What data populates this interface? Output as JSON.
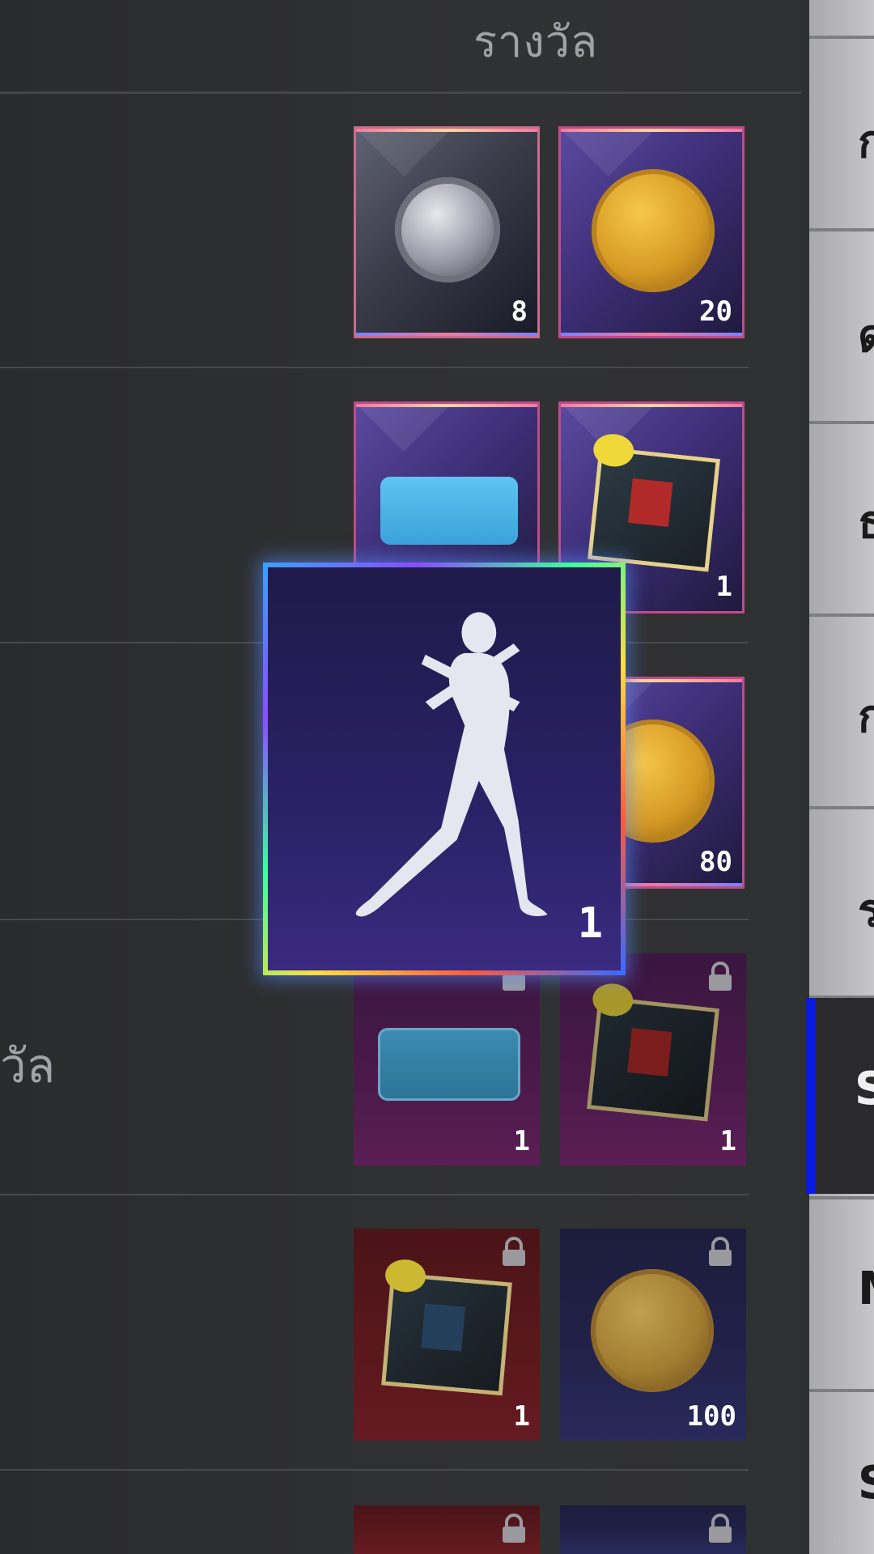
{
  "header": {
    "title": "รางวัล"
  },
  "rows": [
    {
      "label": ""
    },
    {
      "label": ""
    },
    {
      "label": ""
    },
    {
      "label": "วัล"
    },
    {
      "label": ""
    }
  ],
  "tiles": {
    "r1_badge_qty": "8",
    "r1_coin_qty": "20",
    "r2_card_qty": "",
    "r2_photo_qty": "1",
    "r3_coin_qty": "80",
    "r4_card_qty": "1",
    "r4_photo_qty": "1",
    "r5_photo_qty": "1",
    "r5_coin_qty": "100"
  },
  "featured": {
    "qty": "1",
    "icon": "emote-dance-icon"
  },
  "side_tabs": [
    "ก",
    "ด",
    "ธ",
    "ก",
    "ร",
    "S",
    "M",
    "S"
  ],
  "colors": {
    "selected_tab_accent": "#0a1ae0"
  }
}
